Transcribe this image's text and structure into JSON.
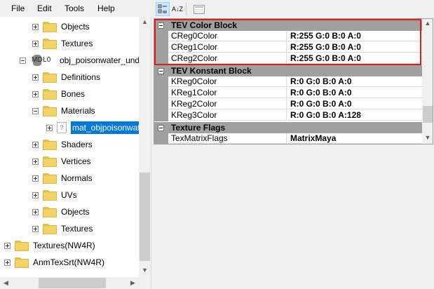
{
  "menu": {
    "items": [
      "File",
      "Edit",
      "Tools",
      "Help"
    ]
  },
  "tree": {
    "items": [
      {
        "label": "Objects",
        "icon": "folder",
        "expander": "plus"
      },
      {
        "label": "Textures",
        "icon": "folder",
        "expander": "plus"
      },
      {
        "label": "obj_poisonwater_under",
        "icon": "mdl0",
        "icon_text": "MDL0",
        "expander": "minus"
      },
      {
        "label": "Definitions",
        "icon": "folder",
        "expander": "plus"
      },
      {
        "label": "Bones",
        "icon": "folder",
        "expander": "plus"
      },
      {
        "label": "Materials",
        "icon": "folder",
        "expander": "minus"
      },
      {
        "label": "mat_objpoisonwat",
        "icon": "material",
        "icon_text": "?",
        "expander": "plus",
        "selected": true
      },
      {
        "label": "Shaders",
        "icon": "folder",
        "expander": "plus"
      },
      {
        "label": "Vertices",
        "icon": "folder",
        "expander": "plus"
      },
      {
        "label": "Normals",
        "icon": "folder",
        "expander": "plus"
      },
      {
        "label": "UVs",
        "icon": "folder",
        "expander": "plus"
      },
      {
        "label": "Objects",
        "icon": "folder",
        "expander": "plus"
      },
      {
        "label": "Textures",
        "icon": "folder",
        "expander": "plus"
      },
      {
        "label": "Textures(NW4R)",
        "icon": "folder",
        "expander": "plus"
      },
      {
        "label": "AnmTexSrt(NW4R)",
        "icon": "folder",
        "expander": "plus"
      }
    ]
  },
  "toolbar": {
    "categorized_icon": "categorized-icon",
    "alphabetical_label": "A↓Z",
    "property_pages_icon": "property-pages-icon"
  },
  "property_grid": {
    "categories": [
      {
        "name": "TEV Color Block",
        "properties": [
          {
            "name": "CReg0Color",
            "value": "R:255 G:0 B:0 A:0"
          },
          {
            "name": "CReg1Color",
            "value": "R:255 G:0 B:0 A:0"
          },
          {
            "name": "CReg2Color",
            "value": "R:255 G:0 B:0 A:0"
          }
        ]
      },
      {
        "name": "TEV Konstant Block",
        "properties": [
          {
            "name": "KReg0Color",
            "value": "R:0 G:0 B:0 A:0"
          },
          {
            "name": "KReg1Color",
            "value": "R:0 G:0 B:0 A:0"
          },
          {
            "name": "KReg2Color",
            "value": "R:0 G:0 B:0 A:0"
          },
          {
            "name": "KReg3Color",
            "value": "R:0 G:0 B:0 A:128"
          }
        ]
      },
      {
        "name": "Texture Flags",
        "properties": [
          {
            "name": "TexMatrixFlags",
            "value": "MatrixMaya"
          }
        ]
      }
    ]
  },
  "colors": {
    "selection": "#0078d7",
    "highlight_border": "#e01b1b",
    "category_band": "#a0a0a0",
    "folder": "#f6d365"
  }
}
